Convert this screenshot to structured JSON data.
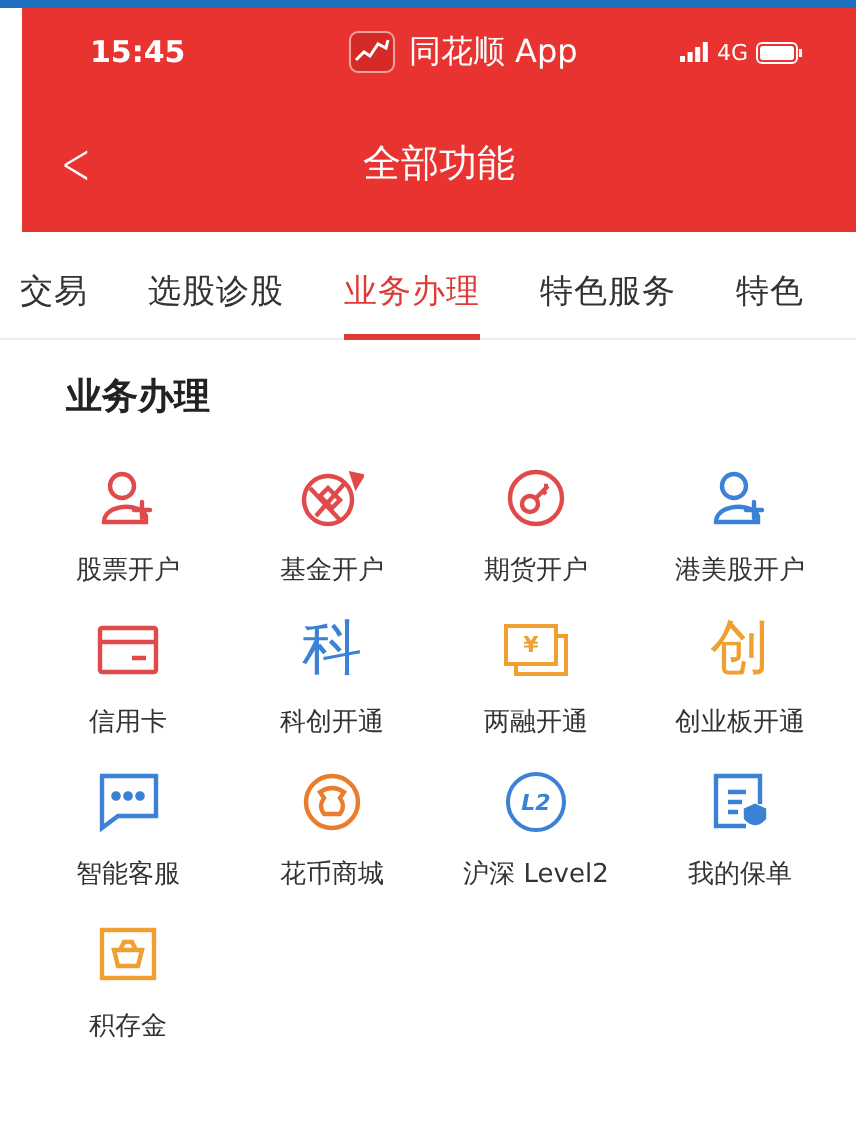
{
  "status_bar": {
    "time": "15:45",
    "app_name": "同花顺 App",
    "network": "4G"
  },
  "nav_bar": {
    "back": "<",
    "title": "全部功能"
  },
  "tabs": [
    {
      "label": "交易",
      "selected": false
    },
    {
      "label": "选股诊股",
      "selected": false
    },
    {
      "label": "业务办理",
      "selected": true
    },
    {
      "label": "特色服务",
      "selected": false
    },
    {
      "label": "特色",
      "selected": false
    }
  ],
  "section": {
    "title": "业务办理",
    "items": [
      {
        "label": "股票开户",
        "kind": "person",
        "color": "#e04a4a"
      },
      {
        "label": "基金开户",
        "kind": "ball",
        "color": "#e04a4a"
      },
      {
        "label": "期货开户",
        "kind": "key",
        "color": "#e04a4a"
      },
      {
        "label": "港美股开户",
        "kind": "person",
        "color": "#3b82d6"
      },
      {
        "label": "信用卡",
        "kind": "card",
        "color": "#e04a4a"
      },
      {
        "label": "科创开通",
        "kind": "glyph",
        "glyph": "科",
        "color": "#3b82d6"
      },
      {
        "label": "两融开通",
        "kind": "money",
        "glyph": "¥",
        "color": "#f0a030"
      },
      {
        "label": "创业板开通",
        "kind": "glyph",
        "glyph": "创",
        "color": "#f0a030"
      },
      {
        "label": "智能客服",
        "kind": "chat",
        "color": "#3b82d6"
      },
      {
        "label": "花币商城",
        "kind": "coin",
        "color": "#ea7d2c"
      },
      {
        "label": "沪深 Level2",
        "kind": "badge",
        "glyph": "L2",
        "color": "#3b82d6"
      },
      {
        "label": "我的保单",
        "kind": "policy",
        "color": "#3b82d6"
      },
      {
        "label": "积存金",
        "kind": "basket",
        "color": "#f0a030"
      }
    ]
  }
}
